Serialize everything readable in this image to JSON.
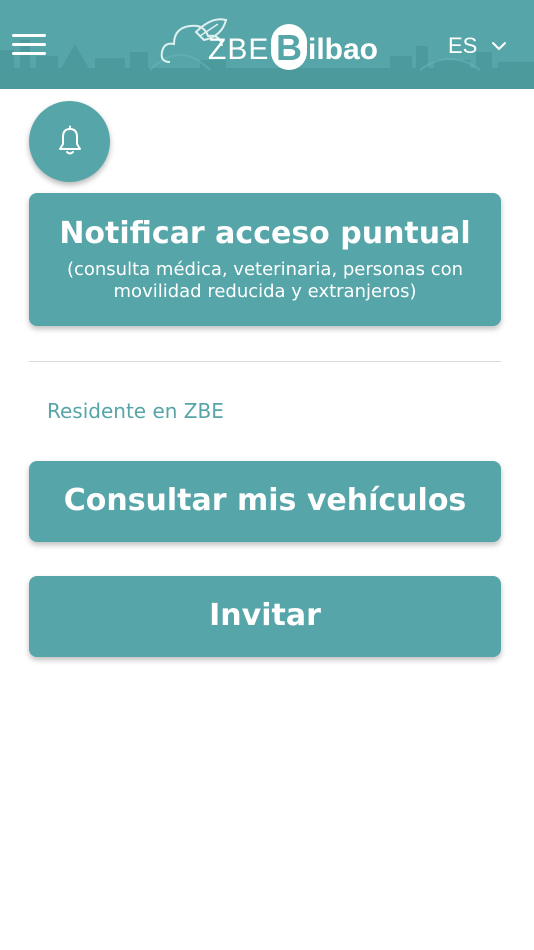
{
  "header": {
    "logo": {
      "zbe": "ZBE",
      "b": "B",
      "ilbao": "ilbao"
    },
    "language": {
      "selected": "ES",
      "icon": "chevron-down-icon"
    },
    "menu_icon": "hamburger-menu-icon"
  },
  "notifications": {
    "icon": "bell-icon"
  },
  "notify_access": {
    "title": "Notificar acceso puntual",
    "subtitle": "(consulta médica, veterinaria, personas con movilidad reducida y extranjeros)"
  },
  "resident_section": {
    "label": "Residente en ZBE",
    "vehicles_button_label": "Consultar mis vehículos",
    "invite_button_label": "Invitar"
  },
  "colors": {
    "primary": "#56a5a8",
    "header_text": "#ffffff",
    "divider": "#d9d9d9"
  }
}
